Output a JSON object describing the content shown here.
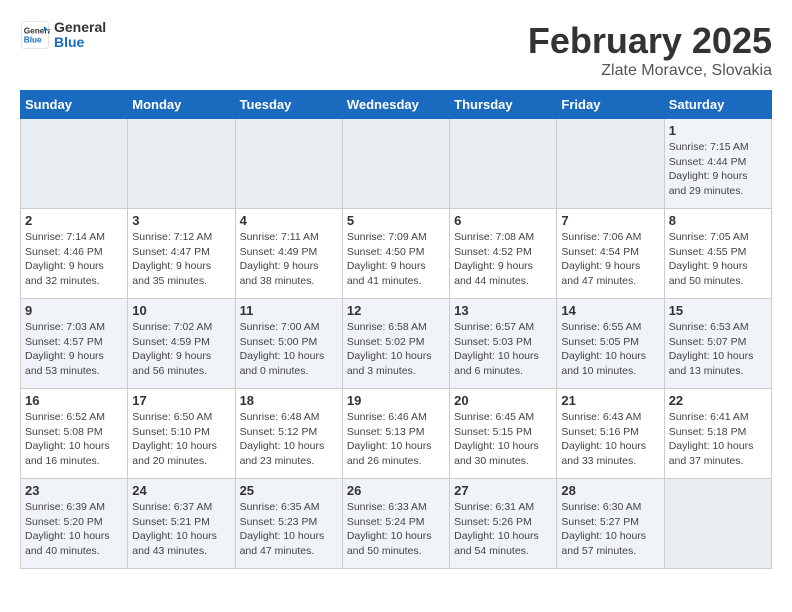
{
  "header": {
    "logo_line1": "General",
    "logo_line2": "Blue",
    "title": "February 2025",
    "subtitle": "Zlate Moravce, Slovakia"
  },
  "weekdays": [
    "Sunday",
    "Monday",
    "Tuesday",
    "Wednesday",
    "Thursday",
    "Friday",
    "Saturday"
  ],
  "weeks": [
    [
      {
        "day": "",
        "info": ""
      },
      {
        "day": "",
        "info": ""
      },
      {
        "day": "",
        "info": ""
      },
      {
        "day": "",
        "info": ""
      },
      {
        "day": "",
        "info": ""
      },
      {
        "day": "",
        "info": ""
      },
      {
        "day": "1",
        "info": "Sunrise: 7:15 AM\nSunset: 4:44 PM\nDaylight: 9 hours and 29 minutes."
      }
    ],
    [
      {
        "day": "2",
        "info": "Sunrise: 7:14 AM\nSunset: 4:46 PM\nDaylight: 9 hours and 32 minutes."
      },
      {
        "day": "3",
        "info": "Sunrise: 7:12 AM\nSunset: 4:47 PM\nDaylight: 9 hours and 35 minutes."
      },
      {
        "day": "4",
        "info": "Sunrise: 7:11 AM\nSunset: 4:49 PM\nDaylight: 9 hours and 38 minutes."
      },
      {
        "day": "5",
        "info": "Sunrise: 7:09 AM\nSunset: 4:50 PM\nDaylight: 9 hours and 41 minutes."
      },
      {
        "day": "6",
        "info": "Sunrise: 7:08 AM\nSunset: 4:52 PM\nDaylight: 9 hours and 44 minutes."
      },
      {
        "day": "7",
        "info": "Sunrise: 7:06 AM\nSunset: 4:54 PM\nDaylight: 9 hours and 47 minutes."
      },
      {
        "day": "8",
        "info": "Sunrise: 7:05 AM\nSunset: 4:55 PM\nDaylight: 9 hours and 50 minutes."
      }
    ],
    [
      {
        "day": "9",
        "info": "Sunrise: 7:03 AM\nSunset: 4:57 PM\nDaylight: 9 hours and 53 minutes."
      },
      {
        "day": "10",
        "info": "Sunrise: 7:02 AM\nSunset: 4:59 PM\nDaylight: 9 hours and 56 minutes."
      },
      {
        "day": "11",
        "info": "Sunrise: 7:00 AM\nSunset: 5:00 PM\nDaylight: 10 hours and 0 minutes."
      },
      {
        "day": "12",
        "info": "Sunrise: 6:58 AM\nSunset: 5:02 PM\nDaylight: 10 hours and 3 minutes."
      },
      {
        "day": "13",
        "info": "Sunrise: 6:57 AM\nSunset: 5:03 PM\nDaylight: 10 hours and 6 minutes."
      },
      {
        "day": "14",
        "info": "Sunrise: 6:55 AM\nSunset: 5:05 PM\nDaylight: 10 hours and 10 minutes."
      },
      {
        "day": "15",
        "info": "Sunrise: 6:53 AM\nSunset: 5:07 PM\nDaylight: 10 hours and 13 minutes."
      }
    ],
    [
      {
        "day": "16",
        "info": "Sunrise: 6:52 AM\nSunset: 5:08 PM\nDaylight: 10 hours and 16 minutes."
      },
      {
        "day": "17",
        "info": "Sunrise: 6:50 AM\nSunset: 5:10 PM\nDaylight: 10 hours and 20 minutes."
      },
      {
        "day": "18",
        "info": "Sunrise: 6:48 AM\nSunset: 5:12 PM\nDaylight: 10 hours and 23 minutes."
      },
      {
        "day": "19",
        "info": "Sunrise: 6:46 AM\nSunset: 5:13 PM\nDaylight: 10 hours and 26 minutes."
      },
      {
        "day": "20",
        "info": "Sunrise: 6:45 AM\nSunset: 5:15 PM\nDaylight: 10 hours and 30 minutes."
      },
      {
        "day": "21",
        "info": "Sunrise: 6:43 AM\nSunset: 5:16 PM\nDaylight: 10 hours and 33 minutes."
      },
      {
        "day": "22",
        "info": "Sunrise: 6:41 AM\nSunset: 5:18 PM\nDaylight: 10 hours and 37 minutes."
      }
    ],
    [
      {
        "day": "23",
        "info": "Sunrise: 6:39 AM\nSunset: 5:20 PM\nDaylight: 10 hours and 40 minutes."
      },
      {
        "day": "24",
        "info": "Sunrise: 6:37 AM\nSunset: 5:21 PM\nDaylight: 10 hours and 43 minutes."
      },
      {
        "day": "25",
        "info": "Sunrise: 6:35 AM\nSunset: 5:23 PM\nDaylight: 10 hours and 47 minutes."
      },
      {
        "day": "26",
        "info": "Sunrise: 6:33 AM\nSunset: 5:24 PM\nDaylight: 10 hours and 50 minutes."
      },
      {
        "day": "27",
        "info": "Sunrise: 6:31 AM\nSunset: 5:26 PM\nDaylight: 10 hours and 54 minutes."
      },
      {
        "day": "28",
        "info": "Sunrise: 6:30 AM\nSunset: 5:27 PM\nDaylight: 10 hours and 57 minutes."
      },
      {
        "day": "",
        "info": ""
      }
    ]
  ]
}
